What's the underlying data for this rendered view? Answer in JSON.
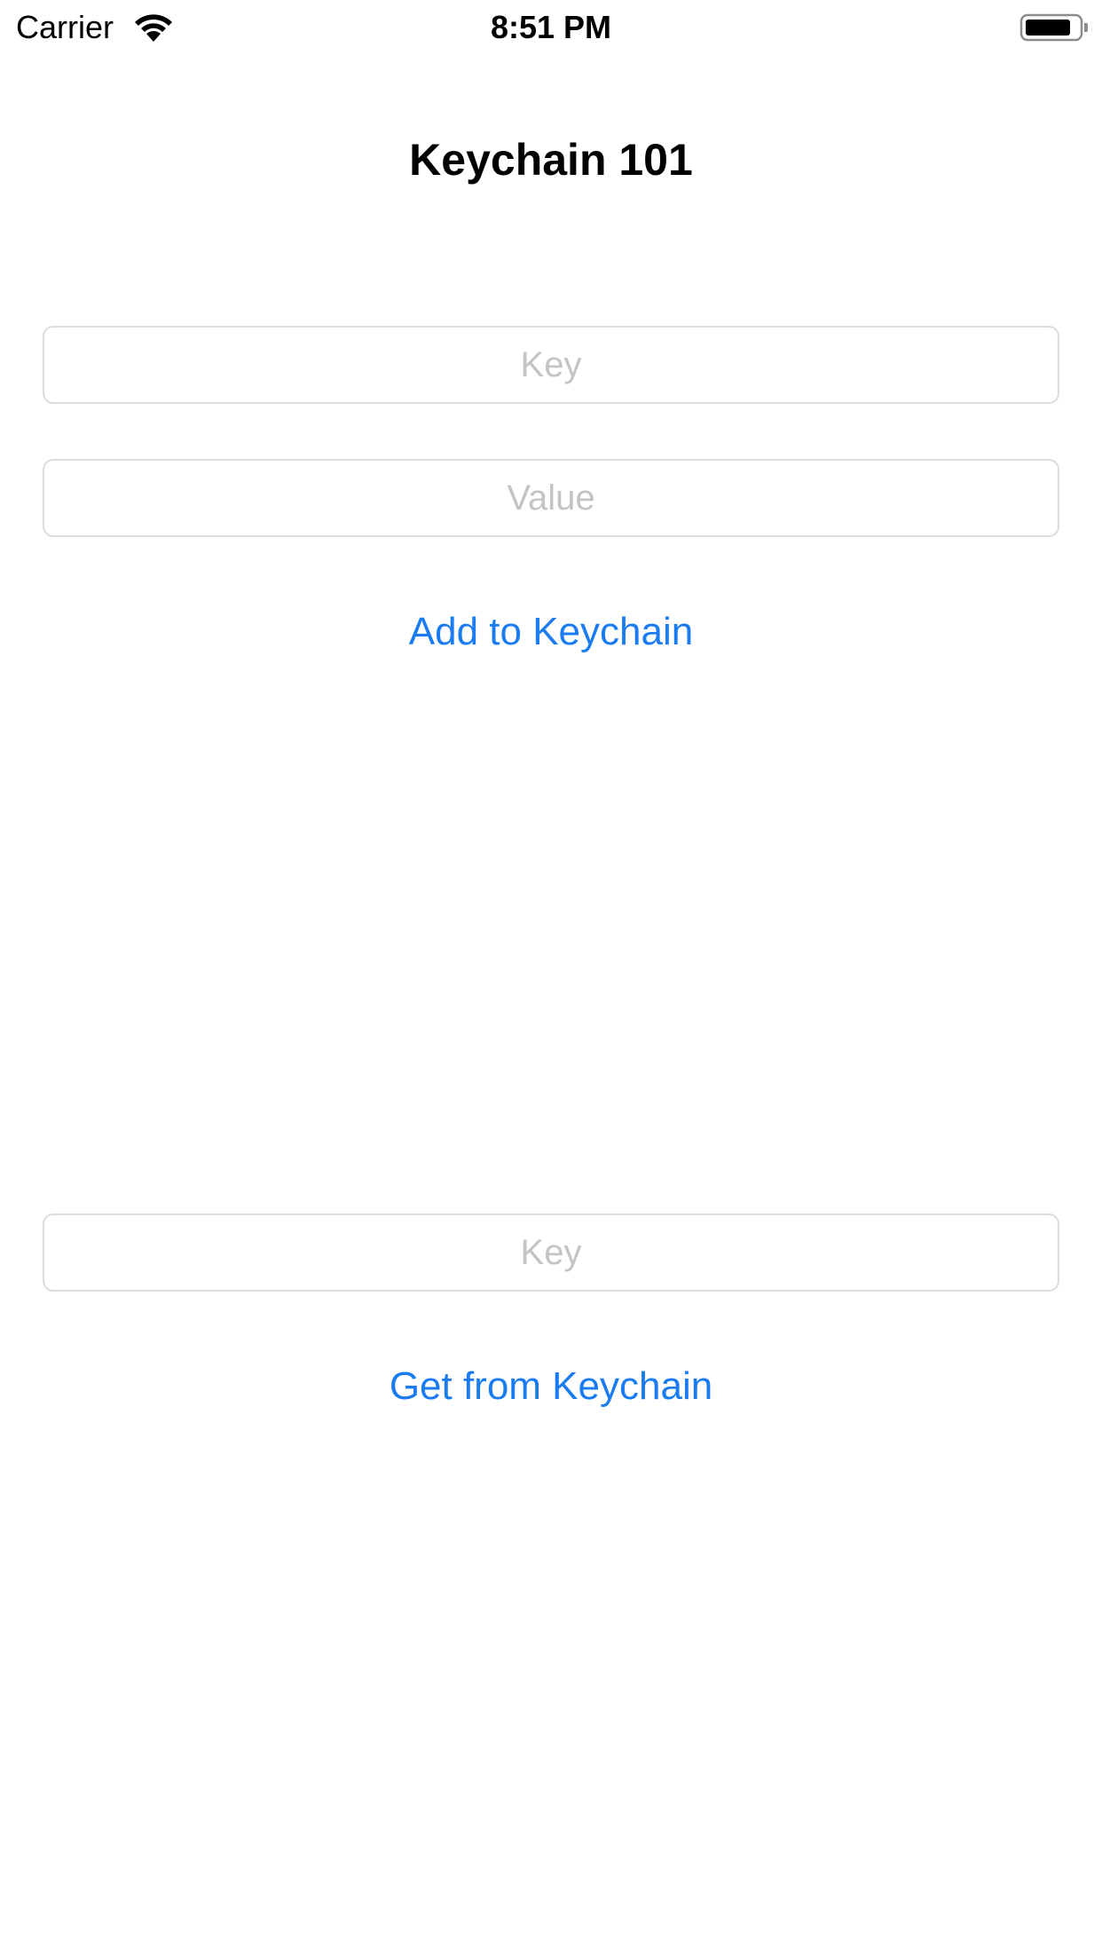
{
  "status_bar": {
    "carrier": "Carrier",
    "time": "8:51 PM",
    "wifi_icon": "wifi-icon",
    "battery_icon": "battery-icon"
  },
  "screen": {
    "title": "Keychain 101"
  },
  "add_section": {
    "key_placeholder": "Key",
    "value_placeholder": "Value",
    "button_label": "Add to Keychain"
  },
  "get_section": {
    "key_placeholder": "Key",
    "button_label": "Get from Keychain"
  },
  "colors": {
    "accent": "#1a7cf0",
    "placeholder": "#c4c4c7",
    "field_border": "#dcdcdc"
  }
}
